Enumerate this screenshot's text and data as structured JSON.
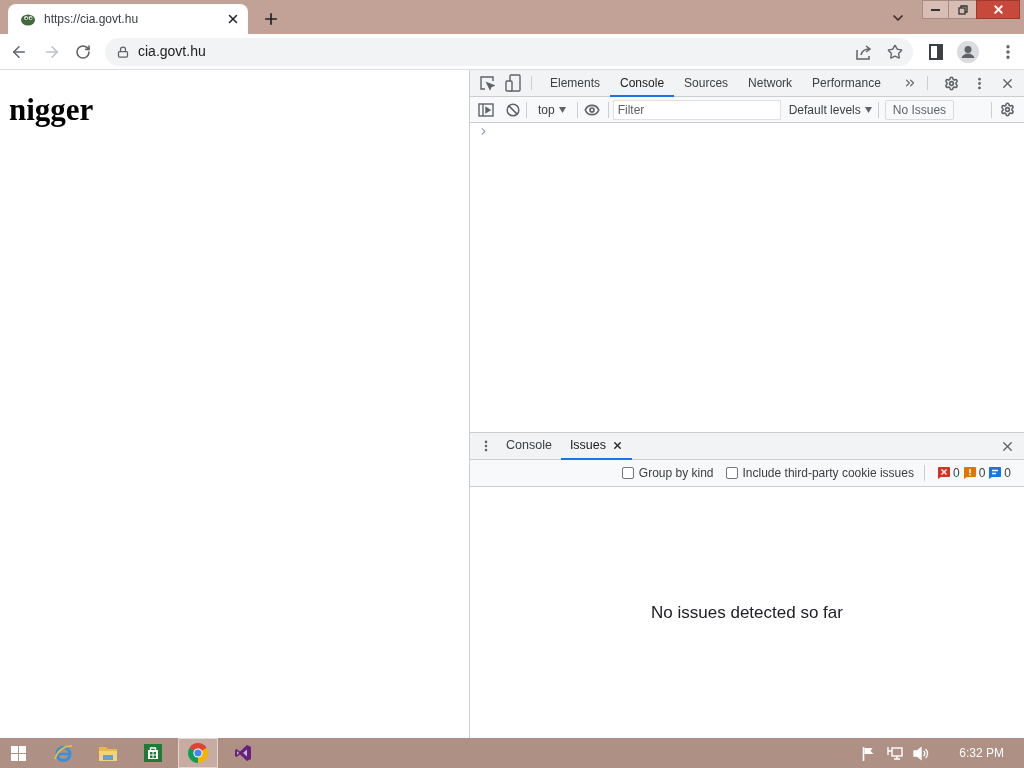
{
  "browser": {
    "tabs": [
      {
        "title": "https://cia.govt.hu",
        "selected": true
      }
    ],
    "address": "cia.govt.hu"
  },
  "page": {
    "heading": "nigger"
  },
  "devtools": {
    "tabs": [
      {
        "label": "Elements",
        "selected": false
      },
      {
        "label": "Console",
        "selected": true
      },
      {
        "label": "Sources",
        "selected": false
      },
      {
        "label": "Network",
        "selected": false
      },
      {
        "label": "Performance",
        "selected": false
      }
    ],
    "console_toolbar": {
      "context": "top",
      "filter_placeholder": "Filter",
      "levels": "Default levels",
      "issues_button": "No Issues"
    },
    "drawer": {
      "tabs": [
        {
          "label": "Console",
          "selected": false,
          "closable": false
        },
        {
          "label": "Issues",
          "selected": true,
          "closable": true
        }
      ],
      "options": [
        {
          "label": "Group by kind",
          "checked": false
        },
        {
          "label": "Include third-party cookie issues",
          "checked": false
        }
      ],
      "counters": [
        {
          "kind": "error",
          "count": "0"
        },
        {
          "kind": "warning",
          "count": "0"
        },
        {
          "kind": "info",
          "count": "0"
        }
      ],
      "empty_message": "No issues detected so far"
    }
  },
  "taskbar": {
    "apps": [
      {
        "kind": "ie",
        "selected": false
      },
      {
        "kind": "explorer",
        "selected": false
      },
      {
        "kind": "store",
        "selected": false
      },
      {
        "kind": "chrome",
        "selected": true
      },
      {
        "kind": "vs",
        "selected": false
      }
    ],
    "clock": "6:32 PM"
  }
}
